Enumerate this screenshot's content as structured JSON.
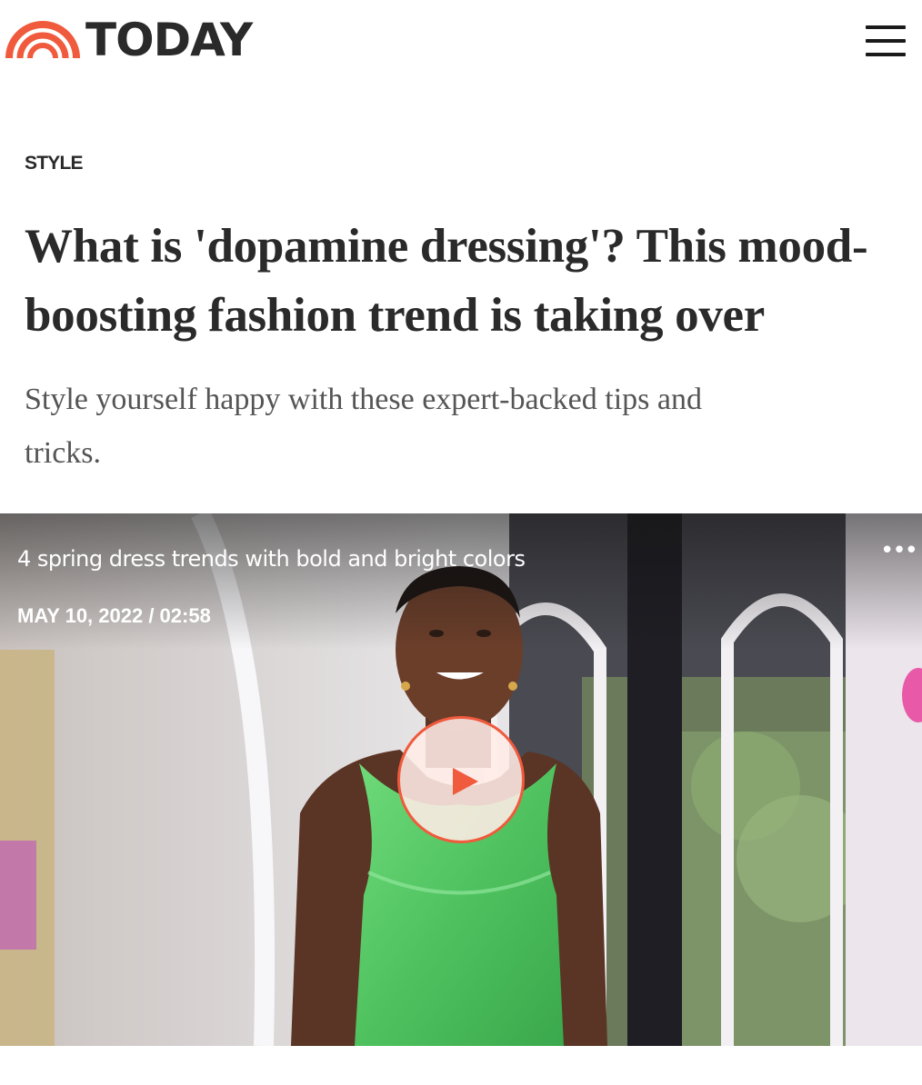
{
  "header": {
    "logo_text": "TODAY",
    "logo_icon": "rainbow-logo-icon",
    "menu_icon": "hamburger-menu-icon"
  },
  "article": {
    "section": "STYLE",
    "headline_line1": "What is 'dopamine dressing'? This mood-",
    "headline_line2": "boosting fashion trend is taking over",
    "dek_line1": "Style yourself happy with these expert-backed tips and",
    "dek_line2": "tricks."
  },
  "video": {
    "title": "4 spring dress trends with bold and bright colors",
    "meta": "MAY 10, 2022 / 02:58",
    "more_icon": "more-dots-icon",
    "more_glyph": "•••",
    "play_icon": "play-icon"
  },
  "colors": {
    "brand_orange": "#f05a3d",
    "text_dark": "#2a2a2a",
    "text_muted": "#555555",
    "dress_green": "#5fce6c"
  }
}
